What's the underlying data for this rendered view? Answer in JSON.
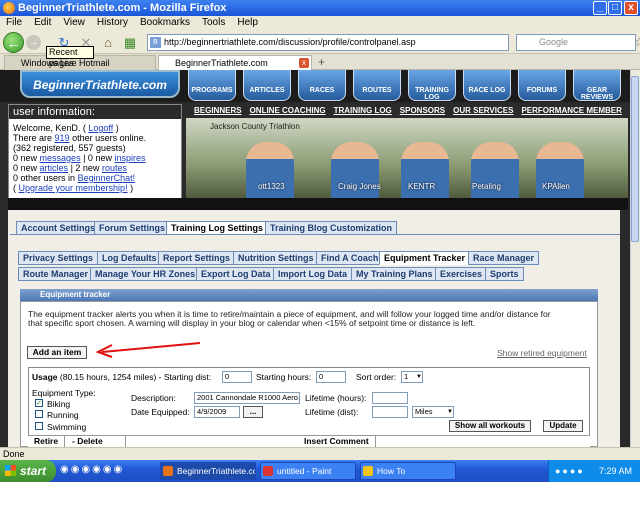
{
  "window": {
    "title": "BeginnerTriathlete.com - Mozilla Firefox",
    "minimize": "_",
    "maximize": "□",
    "close": "x"
  },
  "menu": [
    "File",
    "Edit",
    "View",
    "History",
    "Bookmarks",
    "Tools",
    "Help"
  ],
  "nav": {
    "url": "http://beginnertriathlete.com/discussion/profile/controlpanel.asp",
    "search_placeholder": "Google",
    "tooltip": "Recent pages"
  },
  "browser_tabs": [
    {
      "label": "Windows Live Hotmail",
      "active": false
    },
    {
      "label": "BeginnerTriathlete.com",
      "active": true
    }
  ],
  "site": {
    "logo": "BeginnerTriathlete.com",
    "nav_buttons": [
      "PROGRAMS",
      "ARTICLES",
      "RACES",
      "ROUTES",
      "TRAINING LOG",
      "RACE LOG",
      "FORUMS",
      "GEAR REVIEWS"
    ],
    "top_links": [
      "BEGINNERS",
      "ONLINE COACHING",
      "TRAINING LOG",
      "SPONSORS",
      "OUR SERVICES",
      "PERFORMANCE MEMBER"
    ],
    "photo_caption": "Jackson County Triathlon",
    "photo_labels": [
      "ott1323",
      "Craig Jones",
      "KENTR",
      "Petaling",
      "KPAllen"
    ]
  },
  "user_info": {
    "title": "user information:",
    "welcome": "Welcome, KenD.",
    "logoff": "Logoff",
    "online_prefix": "There are",
    "online_count": "919",
    "online_suffix": "other users online.",
    "registered": "(362 registered, 557 guests)",
    "messages_prefix": "0 new",
    "messages_link": "messages",
    "messages_mid": "| 0 new",
    "inspires_link": "inspires",
    "articles_prefix": "0 new",
    "articles_link": "articles",
    "articles_mid": "| 2 new",
    "routes_link": "routes",
    "chat_prefix": "0 other users in",
    "chat_link": "BeginnerChat!",
    "upgrade_prefix": "(",
    "upgrade_link": "Upgrade your membership!",
    "upgrade_suffix": ")"
  },
  "settings_tabs": [
    "Account Settings",
    "Forum Settings",
    "Training Log Settings",
    "Training Blog Customization"
  ],
  "sub_tabs_row1": [
    "Privacy Settings",
    "Log Defaults",
    "Report Settings",
    "Nutrition Settings",
    "Find A Coach",
    "Equipment Tracker",
    "Race Manager"
  ],
  "sub_tabs_row2": [
    "Route Manager",
    "Manage Your HR Zones",
    "Export Log Data",
    "Import Log Data",
    "My Training Plans",
    "Exercises",
    "Sports"
  ],
  "equipment_tracker": {
    "header": "Equipment tracker",
    "description": "The equipment tracker alerts you when it is time to retire/maintain a piece of equipment, and will follow your logged time and/or distance for that specific sport chosen. A warning will display in your blog or calendar when <15% of setpoint time or distance is left.",
    "add_button": "Add an item",
    "show_retired": "Show retired equipment"
  },
  "usage": {
    "title": "Usage",
    "summary": "(80.15 hours, 1254 miles)",
    "starting_dist_label": "- Starting dist:",
    "starting_dist": "0",
    "starting_hours_label": "Starting hours:",
    "starting_hours": "0",
    "sort_order_label": "Sort order:",
    "sort_order": "1",
    "equipment_type_label": "Equipment Type:",
    "types": [
      {
        "label": "Biking",
        "checked": true
      },
      {
        "label": "Running",
        "checked": false
      },
      {
        "label": "Swimming",
        "checked": false
      }
    ],
    "description_label": "Description:",
    "description_value": "2001 Cannondale R1000 Aero",
    "lifetime_hours_label": "Lifetime (hours):",
    "date_label": "Date Equipped:",
    "date_value": "4/9/2009",
    "date_button": "...",
    "lifetime_dist_label": "Lifetime (dist):",
    "dist_unit": "Miles",
    "show_all": "Show all workouts",
    "update": "Update",
    "col_retire": "Retire",
    "col_delete": "- Delete",
    "col_insert": "Insert Comment"
  },
  "status": "Done",
  "taskbar": {
    "start": "start",
    "items": [
      {
        "label": "BeginnerTriathlete.co...",
        "color": "#e8711b"
      },
      {
        "label": "untitled - Paint",
        "color": "#d33"
      },
      {
        "label": "How To",
        "color": "#f0c419"
      }
    ],
    "clock": "7:29 AM"
  }
}
